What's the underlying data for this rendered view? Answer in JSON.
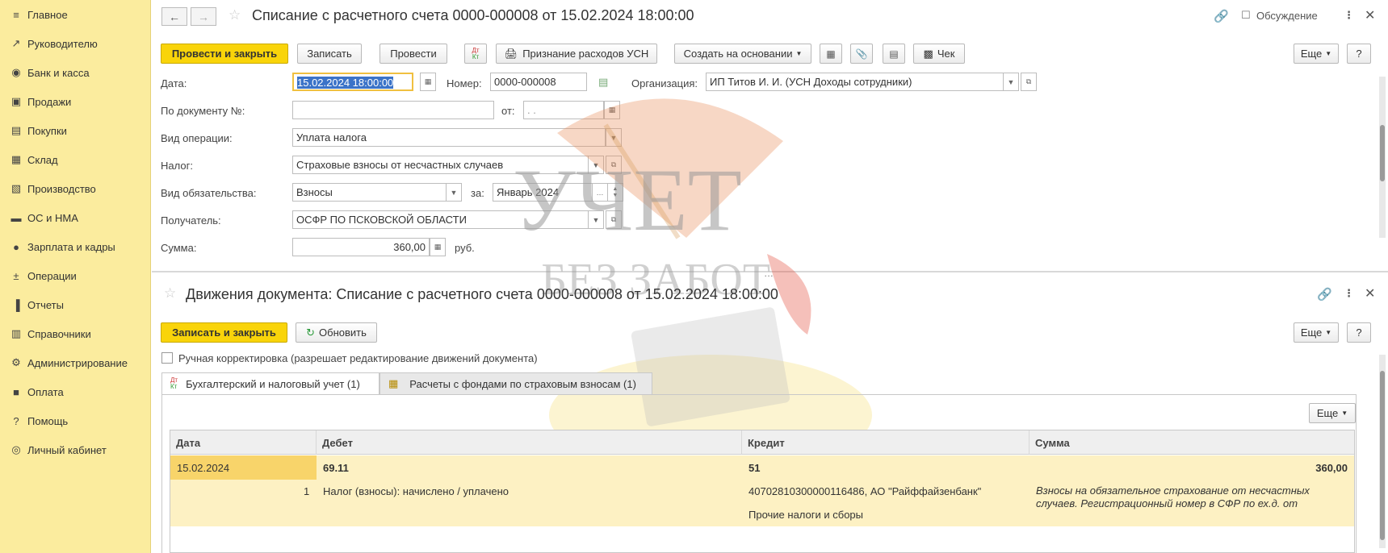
{
  "sidebar": {
    "items": [
      {
        "label": "Главное",
        "icon": "menu-icon"
      },
      {
        "label": "Руководителю",
        "icon": "trend-icon"
      },
      {
        "label": "Банк и касса",
        "icon": "bank-icon"
      },
      {
        "label": "Продажи",
        "icon": "bag-icon"
      },
      {
        "label": "Покупки",
        "icon": "cart-icon"
      },
      {
        "label": "Склад",
        "icon": "warehouse-icon"
      },
      {
        "label": "Производство",
        "icon": "factory-icon"
      },
      {
        "label": "ОС и НМА",
        "icon": "truck-icon"
      },
      {
        "label": "Зарплата и кадры",
        "icon": "person-icon"
      },
      {
        "label": "Операции",
        "icon": "dt-kt-icon"
      },
      {
        "label": "Отчеты",
        "icon": "bar-chart-icon"
      },
      {
        "label": "Справочники",
        "icon": "books-icon"
      },
      {
        "label": "Администрирование",
        "icon": "gear-icon"
      },
      {
        "label": "Оплата",
        "icon": "payment-icon"
      },
      {
        "label": "Помощь",
        "icon": "help-icon"
      },
      {
        "label": "Личный кабинет",
        "icon": "account-icon"
      }
    ]
  },
  "doc": {
    "title": "Списание с расчетного счета 0000-000008 от 15.02.2024 18:00:00",
    "discussion_label": "Обсуждение",
    "toolbar": {
      "post_close": "Провести и закрыть",
      "save": "Записать",
      "post": "Провести",
      "dt_kt": "Дт Кт",
      "usn_expense": "Признание расходов УСН",
      "create_based": "Создать на основании",
      "check": "Чек",
      "more": "Еще",
      "help": "?"
    },
    "form": {
      "date_label": "Дата:",
      "date_value": "15.02.2024 18:00:00",
      "number_label": "Номер:",
      "number_value": "0000-000008",
      "org_label": "Организация:",
      "org_value": "ИП Титов И. И. (УСН Доходы сотрудники)",
      "doc_no_label": "По документу №:",
      "doc_no_value": "",
      "from_label": "от:",
      "from_value": " .  .",
      "operation_label": "Вид операции:",
      "operation_value": "Уплата налога",
      "tax_label": "Налог:",
      "tax_value": "Страховые взносы от несчастных случаев",
      "liability_label": "Вид обязательства:",
      "liability_value": "Взносы",
      "for_label": "за:",
      "for_value": "Январь 2024",
      "recipient_label": "Получатель:",
      "recipient_value": "ОСФР ПО ПСКОВСКОЙ ОБЛАСТИ",
      "sum_label": "Сумма:",
      "sum_value": "360,00",
      "currency": "руб."
    }
  },
  "moves": {
    "title": "Движения документа: Списание с расчетного счета 0000-000008 от 15.02.2024 18:00:00",
    "save_close": "Записать и закрыть",
    "refresh": "Обновить",
    "more": "Еще",
    "help": "?",
    "manual_label": "Ручная корректировка (разрешает редактирование движений документа)",
    "tabs": [
      {
        "label": "Бухгалтерский и налоговый учет (1)",
        "active": true
      },
      {
        "label": "Расчеты с фондами по страховым взносам (1)",
        "active": false
      }
    ],
    "grid_more": "Еще",
    "columns": [
      "Дата",
      "Дебет",
      "Кредит",
      "Сумма"
    ],
    "row": {
      "date": "15.02.2024",
      "num": "1",
      "debit": "69.11",
      "debit_sub": "Налог (взносы): начислено / уплачено",
      "credit": "51",
      "credit_sub1": "40702810300000116486, АО \"Райффайзенбанк\"",
      "credit_sub2": "Прочие налоги и сборы",
      "sum": "360,00",
      "comment1": "Взносы на обязательное страхование от несчастных",
      "comment2": "случаев. Регистрационный номер в СФР по ех.д.  от"
    }
  },
  "watermark": {
    "line1": "УЧЕТ",
    "line2": "БЕЗ ЗАБОТ"
  }
}
